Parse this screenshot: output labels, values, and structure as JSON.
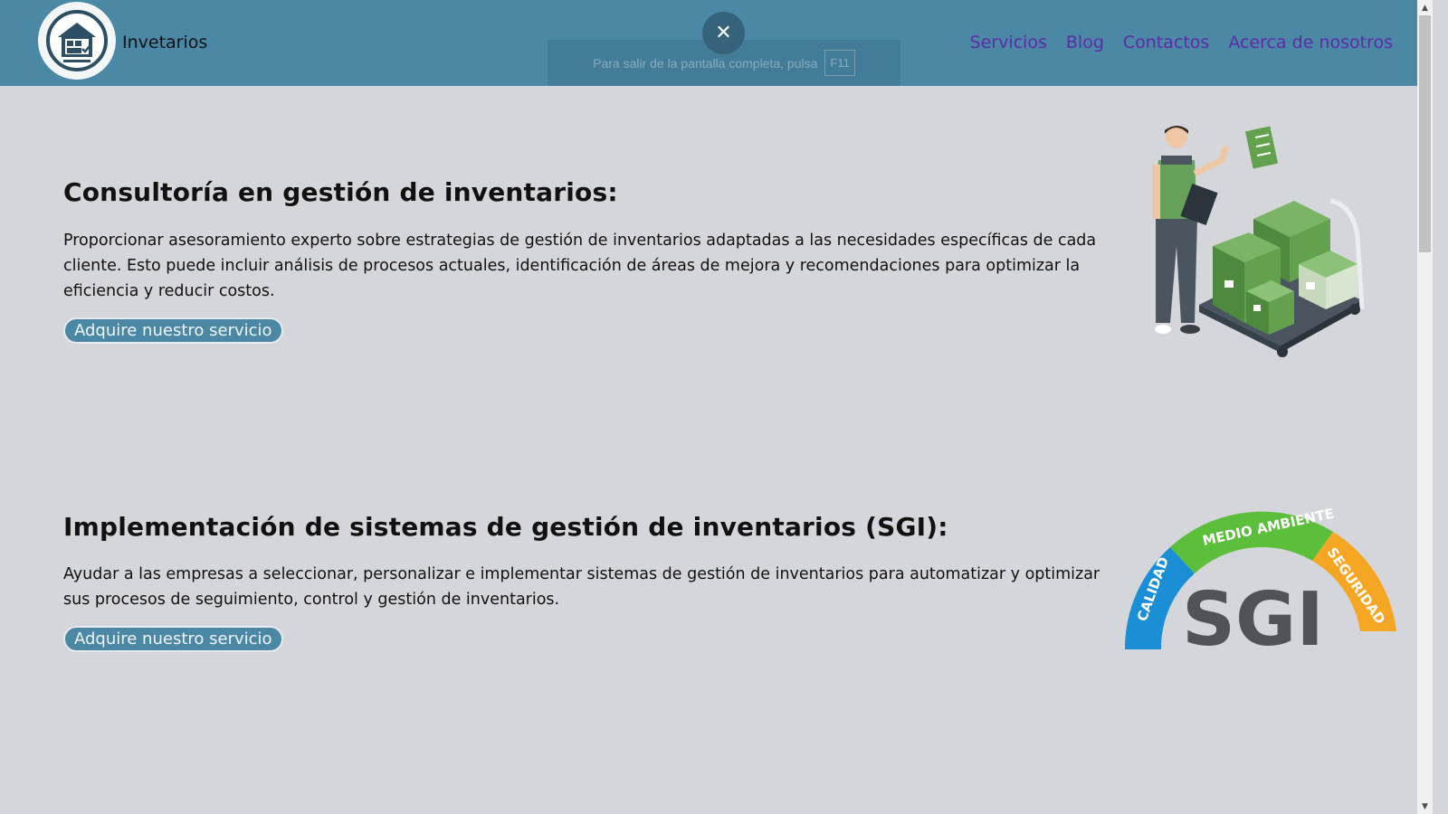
{
  "header": {
    "brand": "Invetarios",
    "nav": [
      "Servicios",
      "Blog",
      "Contactos",
      "Acerca de nosotros"
    ],
    "bg_color": "#4a88a5",
    "link_color": "#5f2aa8"
  },
  "fullscreen_notice": {
    "text": "Para salir de la pantalla completa, pulsa",
    "key": "F11",
    "close_symbol": "✕"
  },
  "sections": [
    {
      "title": "Consultoría en gestión de inventarios:",
      "body": "Proporcionar asesoramiento experto sobre estrategias de gestión de inventarios adaptadas a las necesidades específicas de cada cliente. Esto puede incluir análisis de procesos actuales, identificación de áreas de mejora y recomendaciones para optimizar la eficiencia y reducir costos.",
      "button": "Adquire nuestro servicio",
      "image": "warehouse-worker-boxes-illustration"
    },
    {
      "title": "Implementación de sistemas de gestión de inventarios (SGI):",
      "body": "Ayudar a las empresas a seleccionar, personalizar e implementar sistemas de gestión de inventarios para automatizar y optimizar sus procesos de seguimiento, control y gestión de inventarios.",
      "button": "Adquire nuestro servicio",
      "image": "sgi-logo"
    }
  ],
  "sgi_logo": {
    "text": "SGI",
    "arc_labels": [
      "CALIDAD",
      "MEDIO AMBIENTE",
      "SEGURIDAD"
    ],
    "arc_colors": [
      "#1a8fd6",
      "#5cbf3c",
      "#f5a623"
    ]
  },
  "scrollbar": {
    "up": "▲",
    "down": "▼"
  }
}
